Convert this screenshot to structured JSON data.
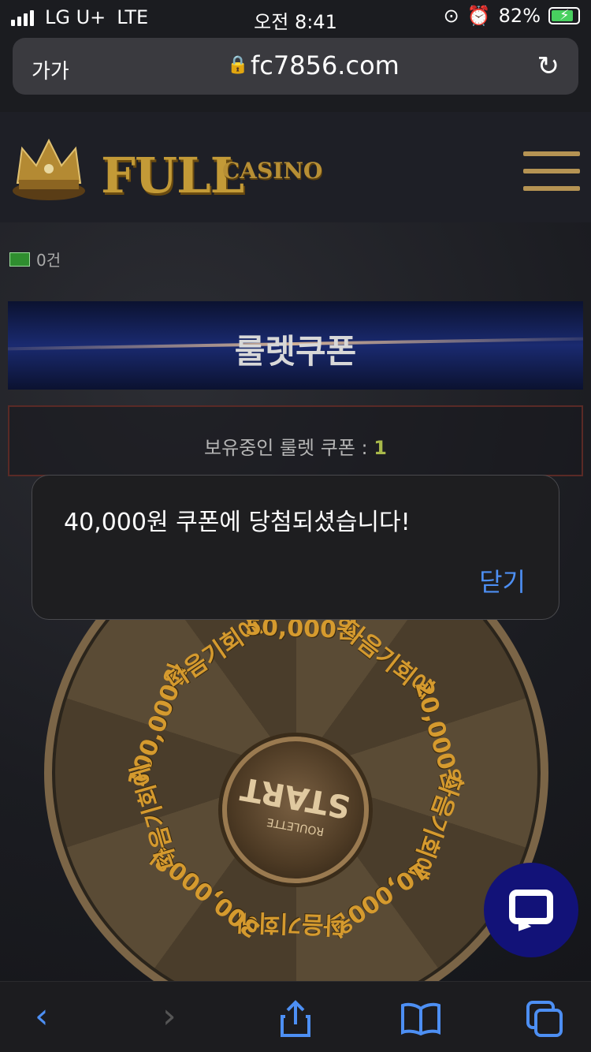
{
  "status": {
    "carrier": "LG U+",
    "network": "LTE",
    "time": "오전 8:41",
    "battery": "82%",
    "battery_level": 0.82
  },
  "browser": {
    "text_size_label": "가가",
    "url": "fc7856.com"
  },
  "site": {
    "logo_main": "FULL",
    "logo_sub": "CASINO",
    "message_count": "0건",
    "page_title": "룰렛쿠폰",
    "coupon_label": "보유중인 룰렛 쿠폰 : ",
    "coupon_count": "1"
  },
  "roulette": {
    "center_main": "START",
    "center_sub": "ROULETTE",
    "segments": [
      "100,000원",
      "다음기회에",
      "50,000원",
      "다음기회에",
      "20,000원",
      "다음기회에",
      "10,000원",
      "다음기회에",
      "300,000원",
      "다음기회에"
    ]
  },
  "alert": {
    "message": "40,000원 쿠폰에 당첨되셨습니다!",
    "close_label": "닫기"
  },
  "colors": {
    "accent": "#4d8ff3",
    "gold": "#d59a2e",
    "chat_fab": "#121278"
  }
}
